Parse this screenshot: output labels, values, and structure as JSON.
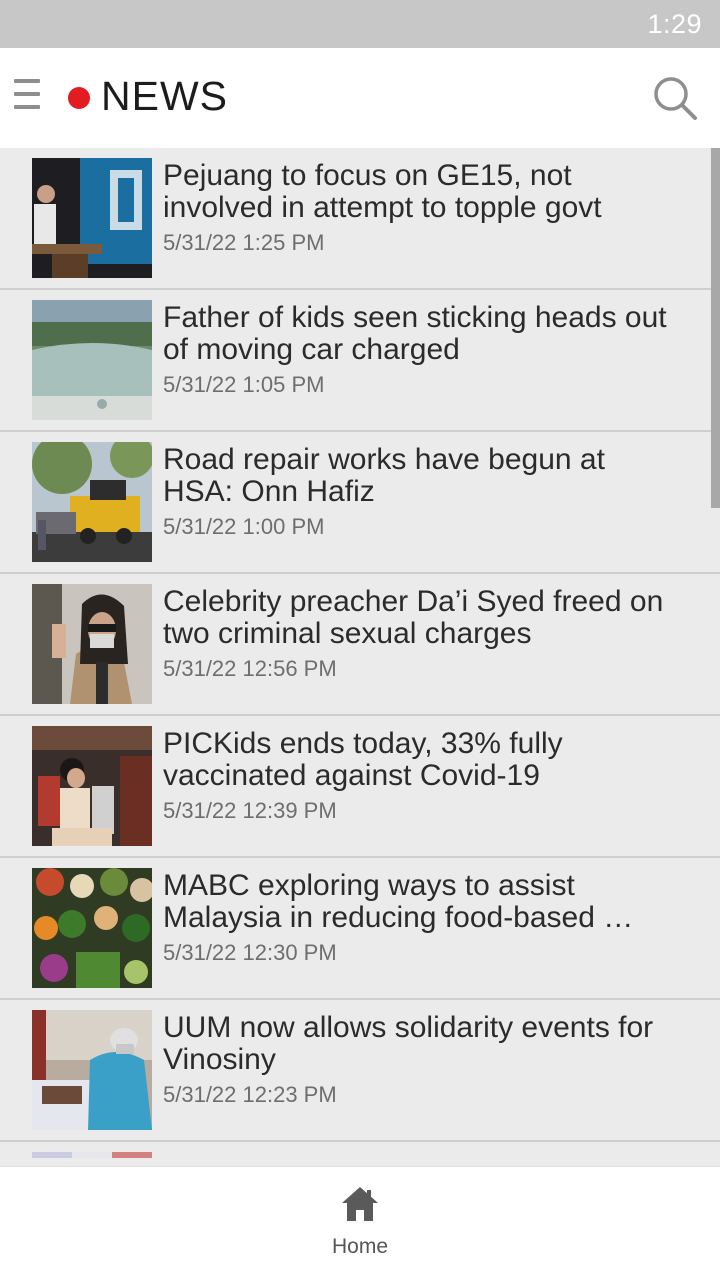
{
  "status_bar": {
    "time": "1:29"
  },
  "header": {
    "menu_icon": "hamburger-menu-icon",
    "logo_text": "NEWS",
    "logo_dot_color": "#e31b23",
    "search_icon": "search-icon"
  },
  "articles": [
    {
      "title": "Pejuang to focus on GE15, not involved in attempt to topple govt",
      "time": "5/31/22 1:25 PM"
    },
    {
      "title": "Father of kids seen sticking heads out of moving car charged",
      "time": "5/31/22 1:05 PM"
    },
    {
      "title": "Road repair works have begun at HSA: Onn Hafiz",
      "time": "5/31/22 1:00 PM"
    },
    {
      "title": "Celebrity preacher Da’i Syed freed on two criminal sexual charges",
      "time": "5/31/22 12:56 PM"
    },
    {
      "title": "PICKids ends today, 33% fully vaccinated against Covid-19",
      "time": "5/31/22 12:39 PM"
    },
    {
      "title": "MABC exploring ways to assist Malaysia in reducing food-based …",
      "time": "5/31/22 12:30 PM"
    },
    {
      "title": "UUM now allows solidarity events for Vinosiny",
      "time": "5/31/22 12:23 PM"
    }
  ],
  "bottom_nav": {
    "home_label": "Home",
    "home_icon": "home-icon"
  }
}
